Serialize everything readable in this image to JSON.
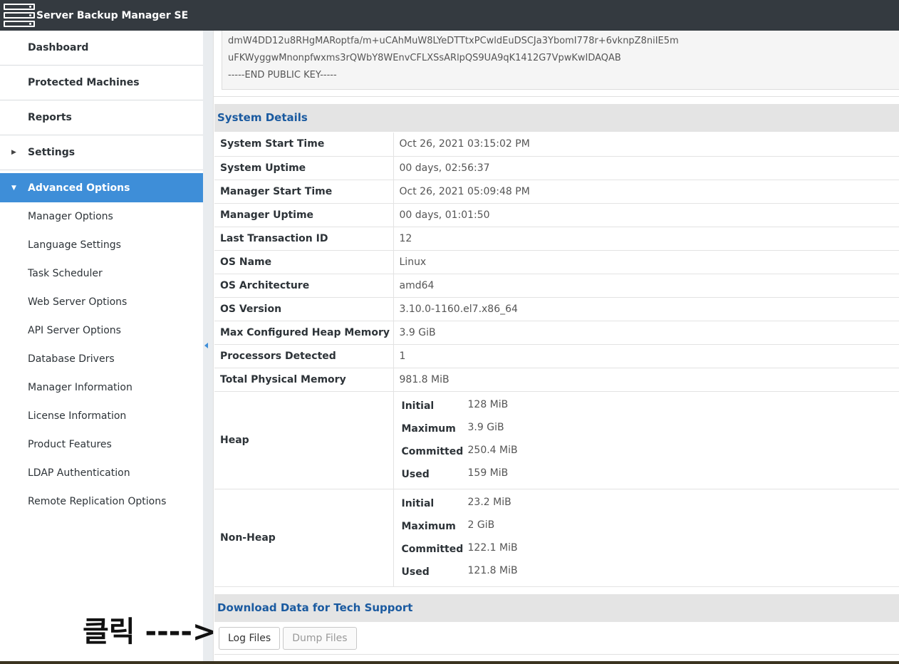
{
  "app": {
    "title": "Server Backup Manager SE"
  },
  "sidebar": {
    "main_items": [
      {
        "label": "Dashboard"
      },
      {
        "label": "Protected Machines"
      },
      {
        "label": "Reports"
      },
      {
        "label": "Settings"
      }
    ],
    "active_item": {
      "label": "Advanced Options"
    },
    "sub_items": [
      {
        "label": "Manager Options"
      },
      {
        "label": "Language Settings"
      },
      {
        "label": "Task Scheduler"
      },
      {
        "label": "Web Server Options"
      },
      {
        "label": "API Server Options"
      },
      {
        "label": "Database Drivers"
      },
      {
        "label": "Manager Information"
      },
      {
        "label": "License Information"
      },
      {
        "label": "Product Features"
      },
      {
        "label": "LDAP Authentication"
      },
      {
        "label": "Remote Replication Options"
      }
    ]
  },
  "public_key": {
    "lines": [
      "dmW4DD12u8RHgMARoptfa/m+uCAhMuW8LYeDTTtxPCwldEuDSCJa3YbomI778r+6vknpZ8niIE5m",
      "uFKWyggwMnonpfwxms3rQWbY8WEnvCFLXSsARlpQS9UA9qK1412G7VpwKwIDAQAB",
      "-----END PUBLIC KEY-----"
    ]
  },
  "system_details": {
    "heading": "System Details",
    "rows": [
      {
        "label": "System Start Time",
        "value": "Oct 26, 2021 03:15:02 PM"
      },
      {
        "label": "System Uptime",
        "value": "00 days, 02:56:37"
      },
      {
        "label": "Manager Start Time",
        "value": "Oct 26, 2021 05:09:48 PM"
      },
      {
        "label": "Manager Uptime",
        "value": "00 days, 01:01:50"
      },
      {
        "label": "Last Transaction ID",
        "value": "12"
      },
      {
        "label": "OS Name",
        "value": "Linux"
      },
      {
        "label": "OS Architecture",
        "value": "amd64"
      },
      {
        "label": "OS Version",
        "value": "3.10.0-1160.el7.x86_64"
      },
      {
        "label": "Max Configured Heap Memory",
        "value": "3.9 GiB"
      },
      {
        "label": "Processors Detected",
        "value": "1"
      },
      {
        "label": "Total Physical Memory",
        "value": "981.8 MiB"
      }
    ],
    "heap": {
      "label": "Heap",
      "initial_label": "Initial",
      "initial": "128 MiB",
      "maximum_label": "Maximum",
      "maximum": "3.9 GiB",
      "committed_label": "Committed",
      "committed": "250.4 MiB",
      "used_label": "Used",
      "used": "159 MiB"
    },
    "non_heap": {
      "label": "Non-Heap",
      "initial_label": "Initial",
      "initial": "23.2 MiB",
      "maximum_label": "Maximum",
      "maximum": "2 GiB",
      "committed_label": "Committed",
      "committed": "122.1 MiB",
      "used_label": "Used",
      "used": "121.8 MiB"
    }
  },
  "tech_support": {
    "heading": "Download Data for Tech Support",
    "log_files_label": "Log Files",
    "dump_files_label": "Dump Files"
  },
  "annotation": {
    "text": "클릭 ---->"
  },
  "colors": {
    "topbar": "#343a40",
    "accent": "#3e8ed8",
    "heading_text": "#1a5aa0"
  }
}
